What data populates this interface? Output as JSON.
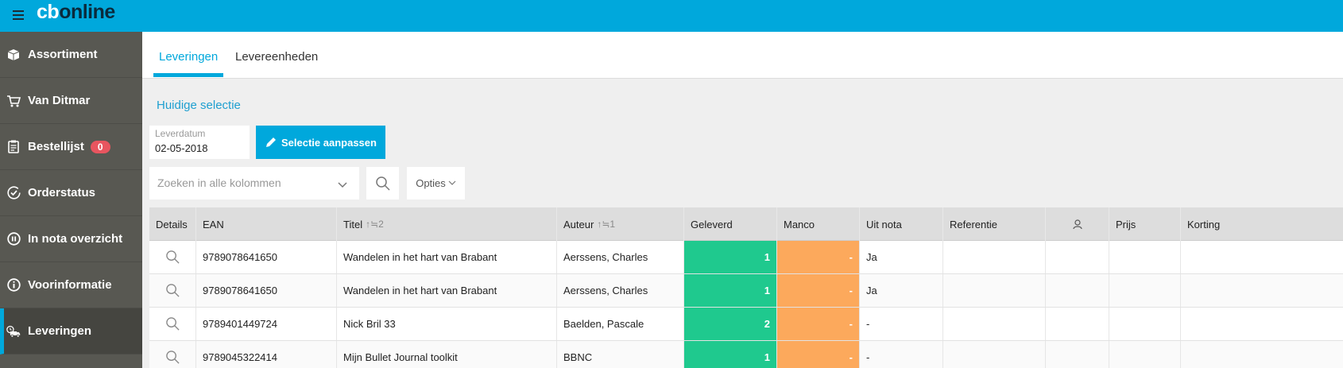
{
  "app": {
    "logo_cb": "cb",
    "logo_online": "online"
  },
  "sidebar": {
    "items": [
      {
        "label": "Assortiment",
        "icon": "box-icon"
      },
      {
        "label": "Van Ditmar",
        "icon": "cart-icon"
      },
      {
        "label": "Bestellijst",
        "icon": "clipboard-icon",
        "badge": "0"
      },
      {
        "label": "Orderstatus",
        "icon": "check-circle-icon"
      },
      {
        "label": "In nota overzicht",
        "icon": "pause-circle-icon"
      },
      {
        "label": "Voorinformatie",
        "icon": "info-circle-icon"
      },
      {
        "label": "Leveringen",
        "icon": "truck-icon",
        "active": true
      }
    ]
  },
  "tabs": [
    {
      "label": "Leveringen",
      "active": true
    },
    {
      "label": "Levereenheden"
    }
  ],
  "selection": {
    "title": "Huidige selectie",
    "date_label": "Leverdatum",
    "date_value": "02-05-2018",
    "edit_button": "Selectie aanpassen"
  },
  "search": {
    "placeholder": "Zoeken in alle kolommen",
    "options_label": "Opties"
  },
  "table": {
    "headers": {
      "details": "Details",
      "ean": "EAN",
      "titel": "Titel",
      "titel_sort": "↑≒2",
      "auteur": "Auteur",
      "auteur_sort": "↑≒1",
      "geleverd": "Geleverd",
      "manco": "Manco",
      "uit_nota": "Uit nota",
      "referentie": "Referentie",
      "prijs": "Prijs",
      "korting": "Korting"
    },
    "rows": [
      {
        "ean": "9789078641650",
        "titel": "Wandelen in het hart van Brabant",
        "auteur": "Aerssens, Charles",
        "geleverd": "1",
        "manco": "-",
        "uit_nota": "Ja"
      },
      {
        "ean": "9789078641650",
        "titel": "Wandelen in het hart van Brabant",
        "auteur": "Aerssens, Charles",
        "geleverd": "1",
        "manco": "-",
        "uit_nota": "Ja"
      },
      {
        "ean": "9789401449724",
        "titel": "Nick Bril 33",
        "auteur": "Baelden, Pascale",
        "geleverd": "2",
        "manco": "-",
        "uit_nota": "-"
      },
      {
        "ean": "9789045322414",
        "titel": "Mijn Bullet Journal toolkit",
        "auteur": "BBNC",
        "geleverd": "1",
        "manco": "-",
        "uit_nota": "-"
      }
    ]
  },
  "colors": {
    "accent": "#00a8dc",
    "sidebar": "#585852",
    "geleverd": "#1fc98e",
    "manco": "#fca95c",
    "badge": "#e8555f"
  }
}
